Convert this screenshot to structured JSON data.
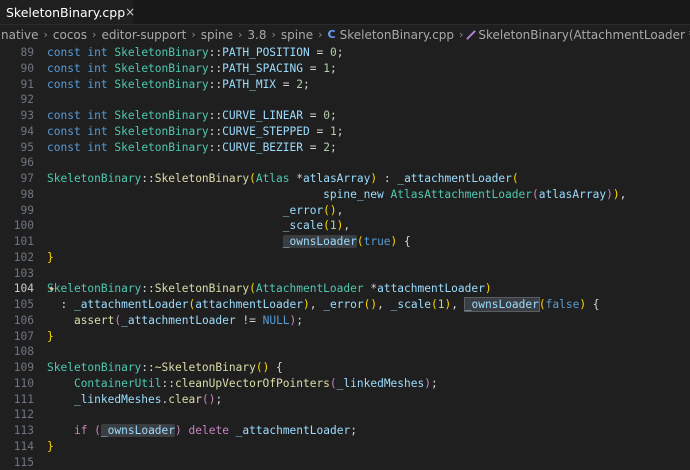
{
  "tab": {
    "filename": "SkeletonBinary.cpp",
    "close_glyph": "×"
  },
  "breadcrumb": [
    "native",
    "cocos",
    "editor-support",
    "spine",
    "3.8",
    "spine",
    "SkeletonBinary.cpp",
    "SkeletonBinary(AttachmentLoader *)"
  ],
  "editor": {
    "active_line": "104",
    "lines": [
      {
        "num": "89",
        "tokens": [
          [
            "k",
            "const "
          ],
          [
            "k",
            "int "
          ],
          [
            "t",
            "SkeletonBinary"
          ],
          [
            "p",
            "::"
          ],
          [
            "v",
            "PATH_POSITION"
          ],
          [
            "p",
            " = "
          ],
          [
            "n",
            "0"
          ],
          [
            "p",
            ";"
          ]
        ]
      },
      {
        "num": "90",
        "tokens": [
          [
            "k",
            "const "
          ],
          [
            "k",
            "int "
          ],
          [
            "t",
            "SkeletonBinary"
          ],
          [
            "p",
            "::"
          ],
          [
            "v",
            "PATH_SPACING"
          ],
          [
            "p",
            " = "
          ],
          [
            "n",
            "1"
          ],
          [
            "p",
            ";"
          ]
        ]
      },
      {
        "num": "91",
        "tokens": [
          [
            "k",
            "const "
          ],
          [
            "k",
            "int "
          ],
          [
            "t",
            "SkeletonBinary"
          ],
          [
            "p",
            "::"
          ],
          [
            "v",
            "PATH_MIX"
          ],
          [
            "p",
            " = "
          ],
          [
            "n",
            "2"
          ],
          [
            "p",
            ";"
          ]
        ]
      },
      {
        "num": "92",
        "tokens": []
      },
      {
        "num": "93",
        "tokens": [
          [
            "k",
            "const "
          ],
          [
            "k",
            "int "
          ],
          [
            "t",
            "SkeletonBinary"
          ],
          [
            "p",
            "::"
          ],
          [
            "v",
            "CURVE_LINEAR"
          ],
          [
            "p",
            " = "
          ],
          [
            "n",
            "0"
          ],
          [
            "p",
            ";"
          ]
        ]
      },
      {
        "num": "94",
        "tokens": [
          [
            "k",
            "const "
          ],
          [
            "k",
            "int "
          ],
          [
            "t",
            "SkeletonBinary"
          ],
          [
            "p",
            "::"
          ],
          [
            "v",
            "CURVE_STEPPED"
          ],
          [
            "p",
            " = "
          ],
          [
            "n",
            "1"
          ],
          [
            "p",
            ";"
          ]
        ]
      },
      {
        "num": "95",
        "tokens": [
          [
            "k",
            "const "
          ],
          [
            "k",
            "int "
          ],
          [
            "t",
            "SkeletonBinary"
          ],
          [
            "p",
            "::"
          ],
          [
            "v",
            "CURVE_BEZIER"
          ],
          [
            "p",
            " = "
          ],
          [
            "n",
            "2"
          ],
          [
            "p",
            ";"
          ]
        ]
      },
      {
        "num": "96",
        "tokens": []
      },
      {
        "num": "97",
        "tokens": [
          [
            "t",
            "SkeletonBinary"
          ],
          [
            "p",
            "::"
          ],
          [
            "f",
            "SkeletonBinary"
          ],
          [
            "y",
            "("
          ],
          [
            "t",
            "Atlas "
          ],
          [
            "p",
            "*"
          ],
          [
            "v",
            "atlasArray"
          ],
          [
            "y",
            ")"
          ],
          [
            "p",
            " : "
          ],
          [
            "v",
            "_attachmentLoader"
          ],
          [
            "y",
            "("
          ]
        ]
      },
      {
        "num": "98",
        "tokens": [
          [
            "p",
            "                                         "
          ],
          [
            "v",
            "spine_new "
          ],
          [
            "t",
            "AtlasAttachmentLoader"
          ],
          [
            "c",
            "("
          ],
          [
            "v",
            "atlasArray"
          ],
          [
            "c",
            ")"
          ],
          [
            "y",
            ")"
          ],
          [
            "p",
            ","
          ]
        ]
      },
      {
        "num": "99",
        "tokens": [
          [
            "p",
            "                                   "
          ],
          [
            "v",
            "_error"
          ],
          [
            "y",
            "("
          ],
          [
            "y",
            ")"
          ],
          [
            "p",
            ","
          ]
        ]
      },
      {
        "num": "100",
        "tokens": [
          [
            "p",
            "                                   "
          ],
          [
            "v",
            "_scale"
          ],
          [
            "y",
            "("
          ],
          [
            "n",
            "1"
          ],
          [
            "y",
            ")"
          ],
          [
            "p",
            ","
          ]
        ]
      },
      {
        "num": "101",
        "tokens": [
          [
            "p",
            "                                   "
          ],
          [
            "vh",
            "_ownsLoader"
          ],
          [
            "y",
            "("
          ],
          [
            "k",
            "true"
          ],
          [
            "y",
            ")"
          ],
          [
            "p",
            " {"
          ]
        ]
      },
      {
        "num": "102",
        "tokens": [
          [
            "y",
            "}"
          ]
        ]
      },
      {
        "num": "103",
        "tokens": []
      },
      {
        "num": "104",
        "tokens": [
          [
            "t",
            "SkeletonBinary"
          ],
          [
            "p",
            "::"
          ],
          [
            "f",
            "SkeletonBinary"
          ],
          [
            "y",
            "("
          ],
          [
            "t",
            "AttachmentLoader "
          ],
          [
            "p",
            "*"
          ],
          [
            "v",
            "attachmentLoader"
          ],
          [
            "y",
            ")"
          ]
        ]
      },
      {
        "num": "105",
        "tokens": [
          [
            "p",
            "  : "
          ],
          [
            "v",
            "_attachmentLoader"
          ],
          [
            "y",
            "("
          ],
          [
            "v",
            "attachmentLoader"
          ],
          [
            "y",
            ")"
          ],
          [
            "p",
            ", "
          ],
          [
            "v",
            "_error"
          ],
          [
            "y",
            "()"
          ],
          [
            "p",
            ", "
          ],
          [
            "v",
            "_scale"
          ],
          [
            "y",
            "("
          ],
          [
            "n",
            "1"
          ],
          [
            "y",
            ")"
          ],
          [
            "p",
            ", "
          ],
          [
            "vb",
            "_ownsLoader"
          ],
          [
            "y",
            "("
          ],
          [
            "k",
            "false"
          ],
          [
            "y",
            ")"
          ],
          [
            "p",
            " {"
          ]
        ]
      },
      {
        "num": "106",
        "tokens": [
          [
            "p",
            "    "
          ],
          [
            "f",
            "assert"
          ],
          [
            "c",
            "("
          ],
          [
            "v",
            "_attachmentLoader"
          ],
          [
            "p",
            " != "
          ],
          [
            "k",
            "NULL"
          ],
          [
            "c",
            ")"
          ],
          [
            "p",
            ";"
          ]
        ]
      },
      {
        "num": "107",
        "tokens": [
          [
            "y",
            "}"
          ]
        ]
      },
      {
        "num": "108",
        "tokens": []
      },
      {
        "num": "109",
        "tokens": [
          [
            "t",
            "SkeletonBinary"
          ],
          [
            "p",
            "::"
          ],
          [
            "f",
            "~SkeletonBinary"
          ],
          [
            "y",
            "()"
          ],
          [
            "p",
            " {"
          ]
        ]
      },
      {
        "num": "110",
        "tokens": [
          [
            "p",
            "    "
          ],
          [
            "t",
            "ContainerUtil"
          ],
          [
            "p",
            "::"
          ],
          [
            "f",
            "cleanUpVectorOfPointers"
          ],
          [
            "c",
            "("
          ],
          [
            "v",
            "_linkedMeshes"
          ],
          [
            "c",
            ")"
          ],
          [
            "p",
            ";"
          ]
        ]
      },
      {
        "num": "111",
        "tokens": [
          [
            "p",
            "    "
          ],
          [
            "v",
            "_linkedMeshes"
          ],
          [
            "p",
            "."
          ],
          [
            "f",
            "clear"
          ],
          [
            "c",
            "()"
          ],
          [
            "p",
            ";"
          ]
        ]
      },
      {
        "num": "112",
        "tokens": []
      },
      {
        "num": "113",
        "tokens": [
          [
            "p",
            "    "
          ],
          [
            "c",
            "if "
          ],
          [
            "c",
            "("
          ],
          [
            "vh",
            "_ownsLoader"
          ],
          [
            "c",
            ")"
          ],
          [
            "p",
            " "
          ],
          [
            "c",
            "delete "
          ],
          [
            "v",
            "_attachmentLoader"
          ],
          [
            "p",
            ";"
          ]
        ]
      },
      {
        "num": "114",
        "tokens": [
          [
            "y",
            "}"
          ]
        ]
      },
      {
        "num": "115",
        "tokens": []
      }
    ]
  }
}
